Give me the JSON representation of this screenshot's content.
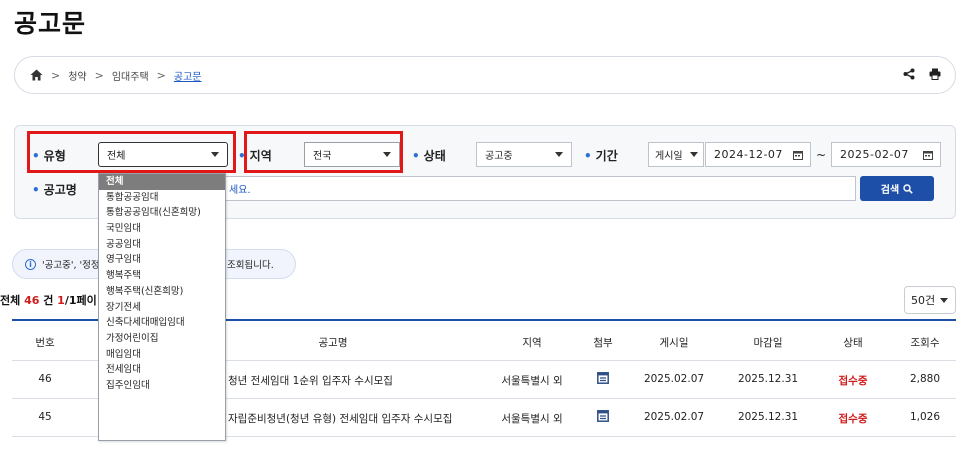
{
  "page": {
    "title": "공고문"
  },
  "breadcrumb": {
    "items": [
      "청약",
      "임대주택",
      "공고문"
    ]
  },
  "filters": {
    "type": {
      "label": "유형",
      "value": "전체"
    },
    "region": {
      "label": "지역",
      "value": "전국"
    },
    "status": {
      "label": "상태",
      "value": "공고중"
    },
    "period": {
      "label": "기간",
      "basis": "게시일",
      "start": "2024-12-07",
      "tilde": "~",
      "end": "2025-02-07"
    },
    "name": {
      "label": "공고명",
      "placeholder_visible": "세요."
    },
    "search_button": "검색"
  },
  "type_options": [
    "전체",
    "통합공공임대",
    "통합공공임대(신혼희망)",
    "국민임대",
    "공공임대",
    "영구임대",
    "행복주택",
    "행복주택(신혼희망)",
    "장기전세",
    "신축다세대매입임대",
    "가정어린이집",
    "매입임대",
    "전세임대",
    "집주인임대"
  ],
  "notice": {
    "prefix": "'공고중', '정정",
    "suffix": "조회됩니다."
  },
  "summary": {
    "total_prefix": "전체 ",
    "total": "46",
    "total_unit": " 건 ",
    "page_current": "1",
    "page_rest": "/1페이"
  },
  "per_page": "50건",
  "table": {
    "headers": [
      "번호",
      "공고명",
      "지역",
      "첨부",
      "게시일",
      "마감일",
      "상태",
      "조회수"
    ],
    "rows": [
      {
        "no": "46",
        "title": "청년 전세임대 1순위 입주자 수시모집",
        "region": "서울특별시 외",
        "posted": "2025.02.07",
        "deadline": "2025.12.31",
        "status": "접수중",
        "views": "2,880"
      },
      {
        "no": "45",
        "title": "자립준비청년(청년 유형) 전세임대 입주자 수시모집",
        "region": "서울특별시 외",
        "posted": "2025.02.07",
        "deadline": "2025.12.31",
        "status": "접수중",
        "views": "1,026"
      }
    ]
  },
  "colors": {
    "accent": "#1e4fa8",
    "status": "#d01c1c",
    "highlight": "#e01818"
  }
}
